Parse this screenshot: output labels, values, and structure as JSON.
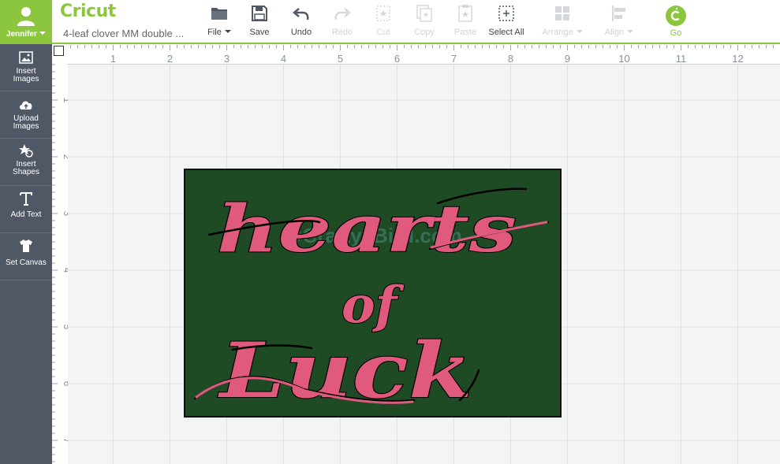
{
  "user": {
    "name": "Jennifer",
    "icon": "user-icon"
  },
  "brand": {
    "logo": "Cricut",
    "project_name": "4-leaf clover MM double ..."
  },
  "toolbar": {
    "file": "File",
    "save": "Save",
    "undo": "Undo",
    "redo": "Redo",
    "cut": "Cut",
    "copy": "Copy",
    "paste": "Paste",
    "select_all": "Select All",
    "arrange": "Arrange",
    "align": "Align",
    "go": "Go"
  },
  "sidebar": {
    "items": [
      {
        "line1": "Insert",
        "line2": "Images",
        "icon": "image-icon"
      },
      {
        "line1": "Upload",
        "line2": "Images",
        "icon": "cloud-upload-icon"
      },
      {
        "line1": "Insert",
        "line2": "Shapes",
        "icon": "shapes-icon"
      },
      {
        "line1": "Add Text",
        "line2": "",
        "icon": "text-icon"
      },
      {
        "line1": "Set Canvas",
        "line2": "",
        "icon": "tshirt-icon"
      }
    ]
  },
  "ruler": {
    "horizontal": [
      "1",
      "2",
      "3",
      "4",
      "5",
      "6",
      "7",
      "8",
      "9",
      "10",
      "11",
      "12"
    ],
    "vertical": [
      "1",
      "2",
      "3",
      "4",
      "5",
      "6",
      "7"
    ]
  },
  "artwork": {
    "line1": "hearts",
    "line2": "of",
    "line3": "Luck",
    "watermark": "@CraftyJBird.com"
  },
  "colors": {
    "brand_green": "#8cc63f",
    "sidebar_bg": "#505866",
    "canvas_bg": "#f3f4f6",
    "grid_line": "#dcdfe4",
    "artwork_bg": "#1f4b24",
    "lettering": "#e05a7e"
  }
}
